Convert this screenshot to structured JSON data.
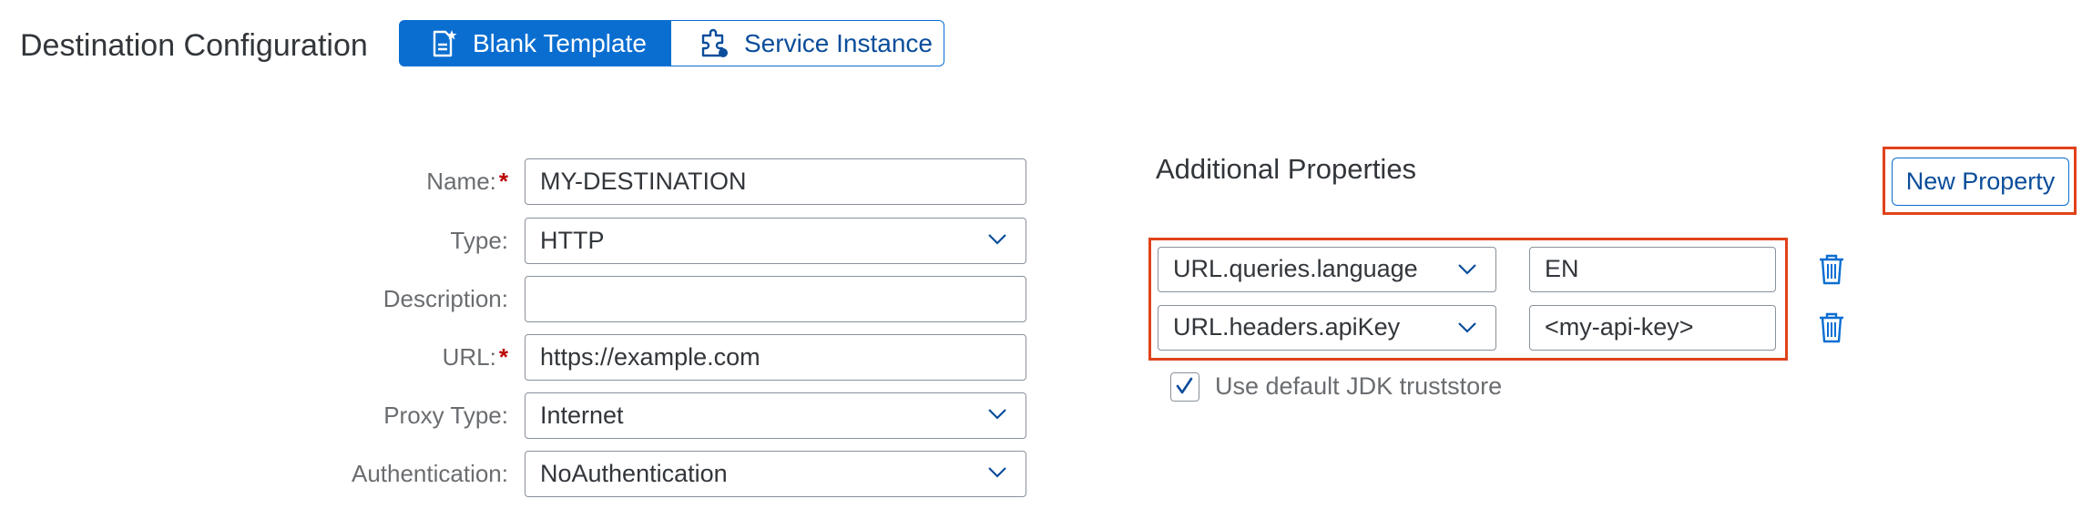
{
  "header": {
    "title": "Destination Configuration",
    "segmented": {
      "blank_template": "Blank Template",
      "service_instance": "Service Instance",
      "selected": "Blank Template"
    }
  },
  "form": {
    "name_label": "Name:",
    "name_value": "MY-DESTINATION",
    "type_label": "Type:",
    "type_value": "HTTP",
    "description_label": "Description:",
    "description_value": "",
    "url_label": "URL:",
    "url_value": "https://example.com",
    "proxy_label": "Proxy Type:",
    "proxy_value": "Internet",
    "auth_label": "Authentication:",
    "auth_value": "NoAuthentication",
    "required_mark": "*"
  },
  "additional": {
    "title": "Additional Properties",
    "new_property_label": "New Property",
    "properties": [
      {
        "key": "URL.queries.language",
        "value": "EN"
      },
      {
        "key": "URL.headers.apiKey",
        "value": "<my-api-key>"
      }
    ],
    "truststore_label": "Use default JDK truststore",
    "truststore_checked": true
  },
  "colors": {
    "accent": "#0a6ed1",
    "highlight": "#e0421a",
    "required": "#bb0000"
  }
}
